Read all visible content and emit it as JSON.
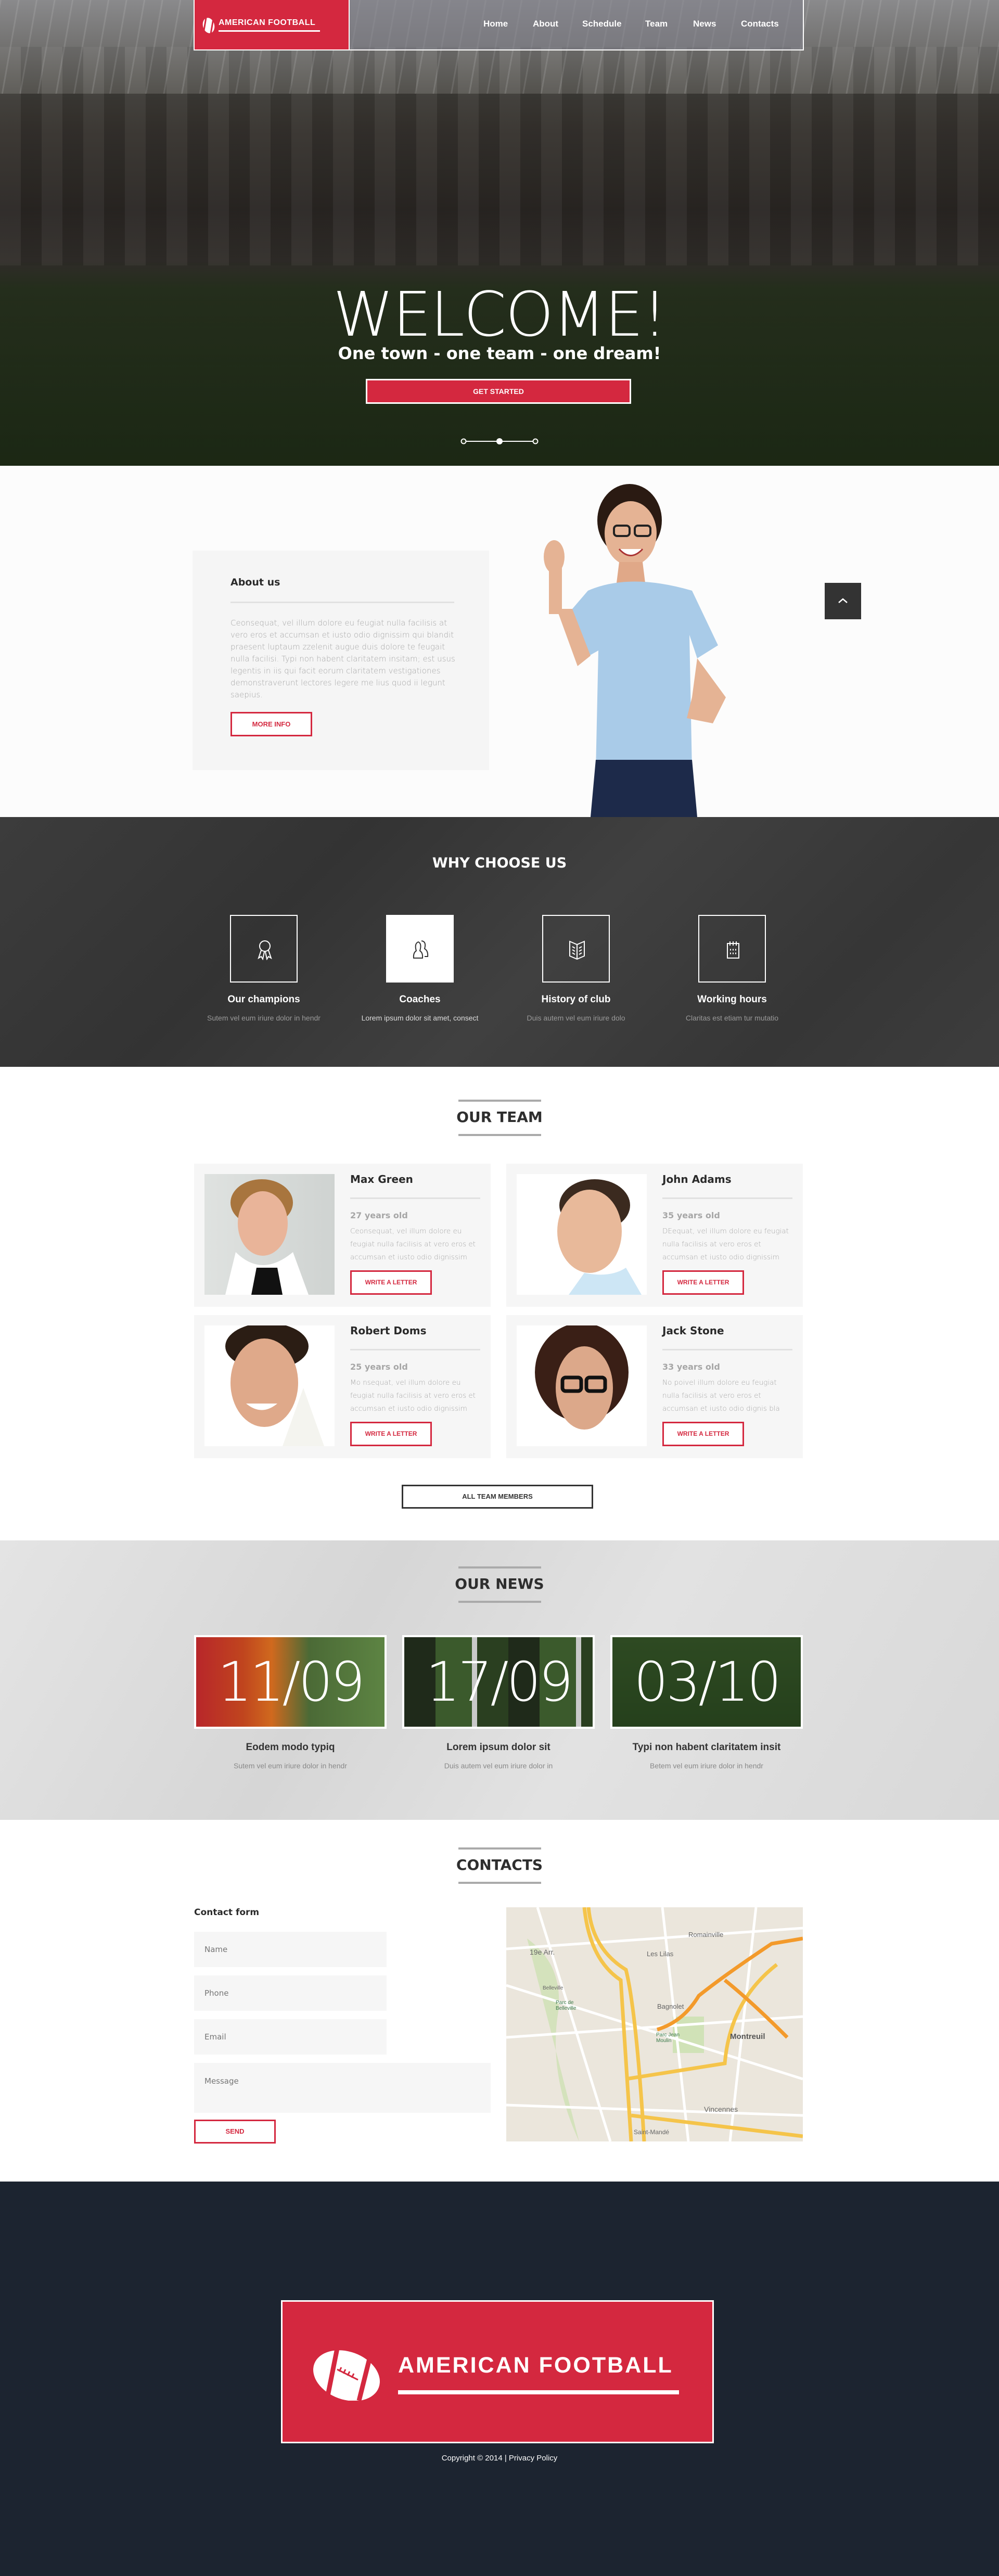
{
  "brand": {
    "name": "AMERICAN FOOTBALL",
    "accent": "#d4283f",
    "dark": "#333333",
    "footer_bg": "#1c2430"
  },
  "nav": {
    "items": [
      "Home",
      "About",
      "Schedule",
      "Team",
      "News",
      "Contacts"
    ]
  },
  "hero": {
    "title": "WELCOME!",
    "subtitle": "One town - one team - one dream!",
    "button": "GET STARTED",
    "slides": 3,
    "active_slide": 2
  },
  "about": {
    "title": "About us",
    "text": "Ceonsequat, vel illum dolore eu feugiat nulla facilisis at vero eros et accumsan et iusto odio dignissim qui blandit praesent luptaum zzelenit augue duis dolore te feugait nulla facilisi. Typi non habent claritatem insitam; est usus legentis in iis qui facit eorum claritatem vestigationes demonstraverunt lectores legere me lius quod ii legunt saepius.",
    "button": "MORE INFO",
    "scroll_top_icon": "chevron-up-icon"
  },
  "why": {
    "title": "WHY CHOOSE US",
    "items": [
      {
        "title": "Our champions",
        "text": "Sutem vel eum iriure dolor in hendr",
        "icon": "award-icon",
        "active": false
      },
      {
        "title": "Coaches",
        "text": "Lorem ipsum dolor sit amet, consect",
        "icon": "users-icon",
        "active": true
      },
      {
        "title": "History of club",
        "text": "Duis autem vel eum iriure dolo",
        "icon": "book-icon",
        "active": false
      },
      {
        "title": "Working hours",
        "text": "Claritas est etiam tur mutatio",
        "icon": "calendar-icon",
        "active": false
      }
    ]
  },
  "team": {
    "title": "OUR TEAM",
    "button": "ALL TEAM MEMBERS",
    "members": [
      {
        "name": "Max Green",
        "age": "27 years old",
        "text": "Ceonsequat, vel illum dolore eu feugiat nulla facilisis at vero eros et accumsan et iusto odio dignissim",
        "button": "WRITE A LETTER"
      },
      {
        "name": "John Adams",
        "age": "35 years old",
        "text": "DEequat, vel illum dolore eu feugiat nulla facilisis at vero eros et accumsan et iusto odio dignissim",
        "button": "WRITE A LETTER"
      },
      {
        "name": "Robert Doms",
        "age": "25 years old",
        "text": "Mo nsequat, vel illum dolore eu feugiat nulla facilisis at vero eros et accumsan et iusto odio dignissim",
        "button": "WRITE A LETTER"
      },
      {
        "name": "Jack Stone",
        "age": "33 years old",
        "text": "No poivel illum dolore eu feugiat nulla facilisis at vero eros et accumsan et iusto odio dignis bla",
        "button": "WRITE A LETTER"
      }
    ]
  },
  "news": {
    "title": "OUR NEWS",
    "items": [
      {
        "date": "11/09",
        "title": "Eodem modo typiq",
        "text": "Sutem vel eum iriure dolor in hendr"
      },
      {
        "date": "17/09",
        "title": "Lorem ipsum dolor sit",
        "text": "Duis autem vel eum iriure dolor in"
      },
      {
        "date": "03/10",
        "title": "Typi non habent claritatem insit",
        "text": "Betem vel eum iriure dolor in hendr"
      }
    ]
  },
  "contacts": {
    "title": "CONTACTS",
    "form_title": "Contact form",
    "placeholders": {
      "name": "Name",
      "phone": "Phone",
      "email": "Email",
      "message": "Message"
    },
    "button": "SEND",
    "map_labels": [
      "Romainville",
      "Les Lilas",
      "Bagnolet",
      "Montreuil",
      "Vincennes",
      "19e Arr.",
      "Belleville",
      "Saint-Mandé",
      "Parc de Belleville",
      "Parc Jean Moulin"
    ]
  },
  "footer": {
    "copyright": "Copyright © 2014",
    "separator": "|",
    "privacy": "Privacy Policy"
  }
}
